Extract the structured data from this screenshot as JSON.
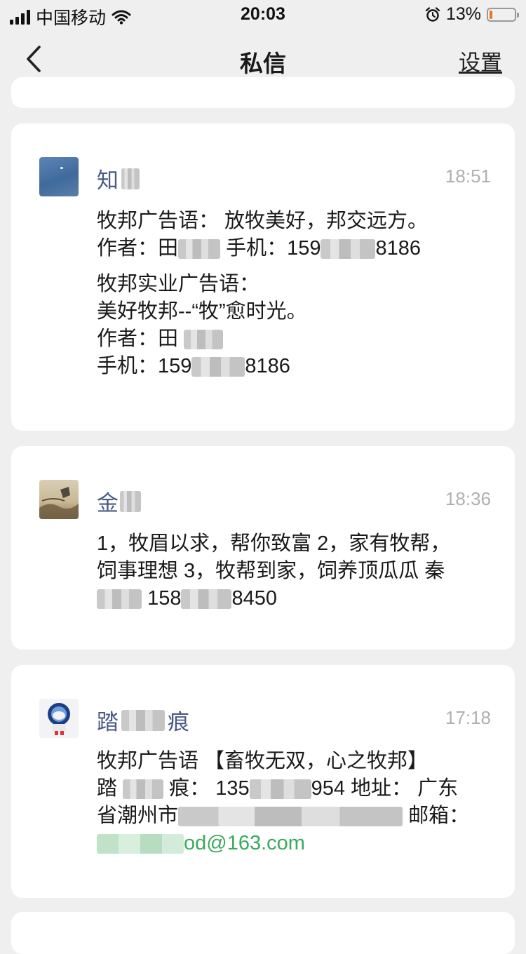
{
  "status_bar": {
    "carrier": "中国移动",
    "time": "20:03",
    "battery_percent": "13%",
    "battery_level": 0.13,
    "battery_color": "#e8751a",
    "icons": [
      "signal-icon",
      "wifi-icon",
      "alarm-icon",
      "battery-icon"
    ]
  },
  "nav": {
    "back_icon": "chevron-left-icon",
    "title": "私信",
    "settings_label": "设置"
  },
  "messages": [
    {
      "name": "知",
      "time": "18:51",
      "lines": {
        "l1": "牧邦广告语： 放牧美好，邦交远方。",
        "l2a": "作者：田",
        "l2b": "手机：159",
        "l2c": "8186",
        "l3": "牧邦实业广告语：",
        "l4": "美好牧邦--“牧”愈时光。",
        "l5": "作者：田",
        "l6a": "手机：159",
        "l6b": "8186"
      }
    },
    {
      "name": "金",
      "time": "18:36",
      "lines": {
        "l1": "1，牧眉以求，帮你致富 2，家有牧帮，",
        "l2": "饲事理想 3，牧帮到家，饲养顶瓜瓜 秦",
        "l3a": "158",
        "l3b": "8450"
      }
    },
    {
      "name_a": "踏",
      "name_b": "痕",
      "time": "17:18",
      "lines": {
        "l1": "牧邦广告语 【畜牧无双，心之牧邦】",
        "l2a": "踏",
        "l2b": "痕： 135",
        "l2c": "954 地址： 广东",
        "l3a": "省潮州市",
        "l3b": "邮箱：",
        "l4": "od@163.com"
      }
    }
  ]
}
